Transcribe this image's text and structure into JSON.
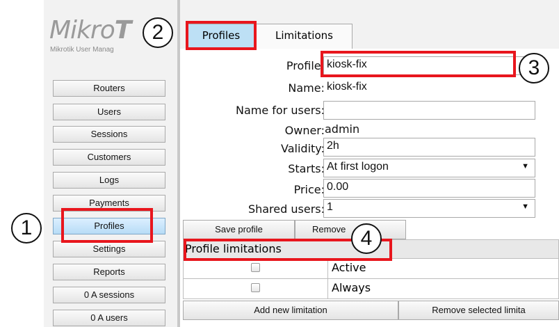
{
  "logo": {
    "text_light": "Mikro",
    "text_bold": "T",
    "subtitle": "Mikrotik User Manag"
  },
  "sidebar": {
    "items": [
      {
        "label": "Routers"
      },
      {
        "label": "Users"
      },
      {
        "label": "Sessions"
      },
      {
        "label": "Customers"
      },
      {
        "label": "Logs"
      },
      {
        "label": "Payments"
      },
      {
        "label": "Profiles"
      },
      {
        "label": "Settings"
      },
      {
        "label": "Reports"
      },
      {
        "label": "0 A sessions"
      },
      {
        "label": "0 A users"
      }
    ],
    "active": "Profiles"
  },
  "tabs": [
    {
      "label": "Profiles"
    },
    {
      "label": "Limitations"
    }
  ],
  "form": {
    "profile_label": "Profile:",
    "profile_value": "kiosk-fix",
    "name_label": "Name:",
    "name_value": "kiosk-fix",
    "name_users_label": "Name for users:",
    "name_users_value": "",
    "owner_label": "Owner:",
    "owner_value": "admin",
    "validity_label": "Validity:",
    "validity_value": "2h",
    "starts_label": "Starts:",
    "starts_value": "At first logon",
    "price_label": "Price:",
    "price_value": "0.00",
    "shared_label": "Shared users:",
    "shared_value": "1"
  },
  "actions": {
    "save": "Save profile",
    "remove": "Remove"
  },
  "limitations": {
    "title": "Profile limitations",
    "rows": [
      {
        "label": "Active"
      },
      {
        "label": "Always"
      }
    ],
    "add": "Add new limitation",
    "remove_selected": "Remove selected limita"
  },
  "callouts": [
    "1",
    "2",
    "3",
    "4"
  ],
  "colors": {
    "highlight": "#e8161d",
    "active_tab": "#bde0f5"
  },
  "icons": {
    "dropdown": "▼"
  }
}
